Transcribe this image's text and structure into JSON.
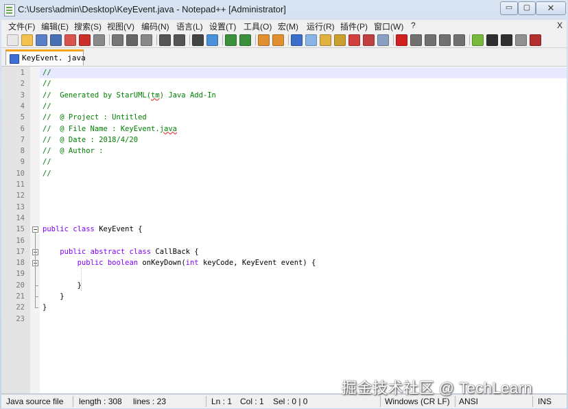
{
  "window": {
    "title": "C:\\Users\\admin\\Desktop\\KeyEvent.java - Notepad++ [Administrator]",
    "min_label": "▭",
    "max_label": "▢",
    "close_label": "✕"
  },
  "menu": {
    "items": [
      "文件(F)",
      "编辑(E)",
      "搜索(S)",
      "视图(V)",
      "编码(N)",
      "语言(L)",
      "设置(T)",
      "工具(O)",
      "宏(M)",
      "运行(R)",
      "插件(P)",
      "窗口(W)",
      "?"
    ],
    "close": "X"
  },
  "toolbar": {
    "icons": [
      "new-file-icon",
      "open-file-icon",
      "save-icon",
      "save-all-icon",
      "close-icon",
      "close-all-icon",
      "print-icon",
      "cut-icon",
      "copy-icon",
      "paste-icon",
      "undo-icon",
      "redo-icon",
      "find-icon",
      "replace-icon",
      "zoom-in-icon",
      "zoom-out-icon",
      "sync-vertical-icon",
      "sync-horizontal-icon",
      "word-wrap-icon",
      "show-all-chars-icon",
      "indent-guide-icon",
      "doc-map-icon",
      "function-list-icon",
      "folder-workspace-icon",
      "monitoring-icon",
      "record-macro-icon",
      "stop-record-icon",
      "play-macro-icon",
      "run-macro-icon",
      "save-macro-icon",
      "android-icon",
      "phone-icon",
      "terminal-icon",
      "settings-icon",
      "spellcheck-icon"
    ]
  },
  "tab": {
    "label": "KeyEvent. java"
  },
  "editor": {
    "lines": [
      {
        "n": "1",
        "code": "//"
      },
      {
        "n": "2",
        "code": "//"
      },
      {
        "n": "3",
        "code": "//  Generated by StarUML(tm) Java Add-In"
      },
      {
        "n": "4",
        "code": "//"
      },
      {
        "n": "5",
        "code": "//  @ Project : Untitled"
      },
      {
        "n": "6",
        "code": "//  @ File Name : KeyEvent.java"
      },
      {
        "n": "7",
        "code": "//  @ Date : 2018/4/20"
      },
      {
        "n": "8",
        "code": "//  @ Author :"
      },
      {
        "n": "9",
        "code": "//"
      },
      {
        "n": "10",
        "code": "//"
      },
      {
        "n": "11",
        "code": ""
      },
      {
        "n": "12",
        "code": ""
      },
      {
        "n": "13",
        "code": ""
      },
      {
        "n": "14",
        "code": ""
      },
      {
        "n": "15",
        "code": "public class KeyEvent {"
      },
      {
        "n": "16",
        "code": ""
      },
      {
        "n": "17",
        "code": "    public abstract class CallBack {"
      },
      {
        "n": "18",
        "code": "        public boolean onKeyDown(int keyCode, KeyEvent event) {"
      },
      {
        "n": "19",
        "code": ""
      },
      {
        "n": "20",
        "code": "        }"
      },
      {
        "n": "21",
        "code": "    }"
      },
      {
        "n": "22",
        "code": "}"
      },
      {
        "n": "23",
        "code": ""
      }
    ]
  },
  "status": {
    "filetype": "Java source file",
    "length": "length : 308",
    "lines": "lines : 23",
    "ln": "Ln : 1",
    "col": "Col : 1",
    "sel": "Sel : 0 | 0",
    "eol": "Windows (CR LF)",
    "encoding": "ANSI",
    "mode": "INS"
  },
  "watermark": "掘金技术社区 @ TechLearn"
}
